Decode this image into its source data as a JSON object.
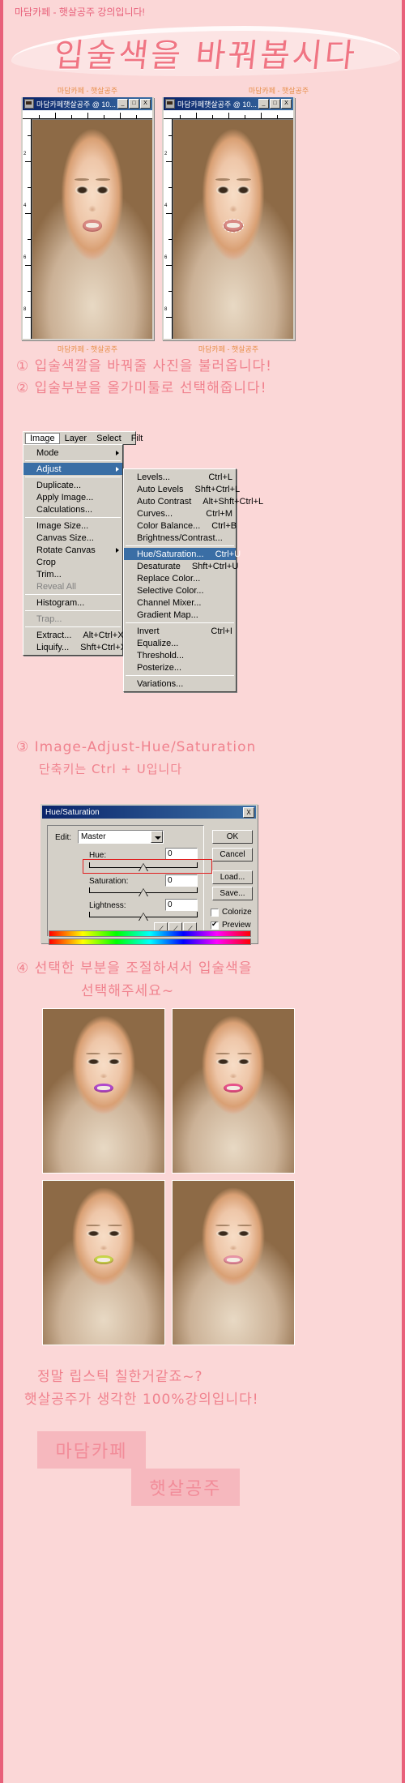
{
  "page": {
    "top_notice": "마담카페 - 햇살공주 강의입니다!",
    "banner_title": "입술색을 바꿔봅시다",
    "accent_color": "#f0828e",
    "border_color": "#e8607a",
    "background_color": "#fbd7d7"
  },
  "windows": [
    {
      "caption_above": "마담카페 - 햇살공주",
      "title": "마담카페햇살공주 @ 10...",
      "minimize": "_",
      "maximize": "□",
      "close": "X",
      "ruler_labels": [
        "2",
        "4",
        "6",
        "8"
      ],
      "caption_below": "마담카페 - 햇살공주"
    },
    {
      "caption_above": "마담카페 - 햇살공주",
      "title": "마담카페햇살공주 @ 10...",
      "minimize": "_",
      "maximize": "□",
      "close": "X",
      "ruler_labels": [
        "2",
        "4",
        "6",
        "8"
      ],
      "caption_below": "마담카페 - 햇살공주"
    }
  ],
  "steps": {
    "step1": "① 입술색깔을 바꿔줄 사진을 불러옵니다!",
    "step2": "② 입술부분을 올가미툴로 선택해줍니다!",
    "step3_line1": "③ Image-Adjust-Hue/Saturation",
    "step3_line2": "단축키는 Ctrl + U입니다",
    "step4_line1": "④ 선택한 부분을 조절하셔서  입술색을",
    "step4_line2": "선택해주세요~"
  },
  "menubar": {
    "items": [
      {
        "label": "Image",
        "active": true
      },
      {
        "label": "Layer",
        "active": false
      },
      {
        "label": "Select",
        "active": false
      },
      {
        "label": "Filt",
        "active": false
      }
    ]
  },
  "image_menu": {
    "items": [
      {
        "label": "Mode",
        "accel": "",
        "submenu": true,
        "selected": false,
        "disabled": false
      },
      {
        "separator": true
      },
      {
        "label": "Adjust",
        "accel": "",
        "submenu": true,
        "selected": true,
        "disabled": false
      },
      {
        "separator": true
      },
      {
        "label": "Duplicate...",
        "accel": "",
        "submenu": false,
        "selected": false,
        "disabled": false
      },
      {
        "label": "Apply Image...",
        "accel": "",
        "submenu": false,
        "selected": false,
        "disabled": false
      },
      {
        "label": "Calculations...",
        "accel": "",
        "submenu": false,
        "selected": false,
        "disabled": false
      },
      {
        "separator": true
      },
      {
        "label": "Image Size...",
        "accel": "",
        "submenu": false,
        "selected": false,
        "disabled": false
      },
      {
        "label": "Canvas Size...",
        "accel": "",
        "submenu": false,
        "selected": false,
        "disabled": false
      },
      {
        "label": "Rotate Canvas",
        "accel": "",
        "submenu": true,
        "selected": false,
        "disabled": false
      },
      {
        "label": "Crop",
        "accel": "",
        "submenu": false,
        "selected": false,
        "disabled": false
      },
      {
        "label": "Trim...",
        "accel": "",
        "submenu": false,
        "selected": false,
        "disabled": false
      },
      {
        "label": "Reveal All",
        "accel": "",
        "submenu": false,
        "selected": false,
        "disabled": true
      },
      {
        "separator": true
      },
      {
        "label": "Histogram...",
        "accel": "",
        "submenu": false,
        "selected": false,
        "disabled": false
      },
      {
        "separator": true
      },
      {
        "label": "Trap...",
        "accel": "",
        "submenu": false,
        "selected": false,
        "disabled": true
      },
      {
        "separator": true
      },
      {
        "label": "Extract...",
        "accel": "Alt+Ctrl+X",
        "submenu": false,
        "selected": false,
        "disabled": false
      },
      {
        "label": "Liquify...",
        "accel": "Shft+Ctrl+X",
        "submenu": false,
        "selected": false,
        "disabled": false
      }
    ]
  },
  "adjust_menu": {
    "items": [
      {
        "label": "Levels...",
        "accel": "Ctrl+L",
        "selected": false,
        "disabled": false
      },
      {
        "label": "Auto Levels",
        "accel": "Shft+Ctrl+L",
        "selected": false,
        "disabled": false
      },
      {
        "label": "Auto Contrast",
        "accel": "Alt+Shft+Ctrl+L",
        "selected": false,
        "disabled": false
      },
      {
        "label": "Curves...",
        "accel": "Ctrl+M",
        "selected": false,
        "disabled": false
      },
      {
        "label": "Color Balance...",
        "accel": "Ctrl+B",
        "selected": false,
        "disabled": false
      },
      {
        "label": "Brightness/Contrast...",
        "accel": "",
        "selected": false,
        "disabled": false
      },
      {
        "separator": true
      },
      {
        "label": "Hue/Saturation...",
        "accel": "Ctrl+U",
        "selected": true,
        "disabled": false
      },
      {
        "label": "Desaturate",
        "accel": "Shft+Ctrl+U",
        "selected": false,
        "disabled": false
      },
      {
        "label": "Replace Color...",
        "accel": "",
        "selected": false,
        "disabled": false
      },
      {
        "label": "Selective Color...",
        "accel": "",
        "selected": false,
        "disabled": false
      },
      {
        "label": "Channel Mixer...",
        "accel": "",
        "selected": false,
        "disabled": false
      },
      {
        "label": "Gradient Map...",
        "accel": "",
        "selected": false,
        "disabled": false
      },
      {
        "separator": true
      },
      {
        "label": "Invert",
        "accel": "Ctrl+I",
        "selected": false,
        "disabled": false
      },
      {
        "label": "Equalize...",
        "accel": "",
        "selected": false,
        "disabled": false
      },
      {
        "label": "Threshold...",
        "accel": "",
        "selected": false,
        "disabled": false
      },
      {
        "label": "Posterize...",
        "accel": "",
        "selected": false,
        "disabled": false
      },
      {
        "separator": true
      },
      {
        "label": "Variations...",
        "accel": "",
        "selected": false,
        "disabled": false
      }
    ]
  },
  "dialog": {
    "title": "Hue/Saturation",
    "close_label": "X",
    "edit_label": "Edit:",
    "edit_value": "Master",
    "hue_label": "Hue:",
    "hue_value": "0",
    "saturation_label": "Saturation:",
    "saturation_value": "0",
    "lightness_label": "Lightness:",
    "lightness_value": "0",
    "ok_label": "OK",
    "cancel_label": "Cancel",
    "load_label": "Load...",
    "save_label": "Save...",
    "colorize_label": "Colorize",
    "colorize_checked": false,
    "preview_label": "Preview",
    "preview_checked": true,
    "eyedroppers": [
      "eyedropper-icon",
      "eyedropper-plus-icon",
      "eyedropper-minus-icon"
    ]
  },
  "results": [
    {
      "name": "result-purple-lips",
      "lip_color": "#b04ad0"
    },
    {
      "name": "result-pink-lips",
      "lip_color": "#e8528c"
    },
    {
      "name": "result-yellow-green-lips",
      "lip_color": "#c8d84a"
    },
    {
      "name": "result-light-pink-lips",
      "lip_color": "#e896a8"
    }
  ],
  "footer": {
    "line1": "정말 립스틱 칠한거같죠~?",
    "line2": "햇살공주가 생각한 100%강의입니다!",
    "sig1": "마담카페",
    "sig2": "햇살공주"
  }
}
